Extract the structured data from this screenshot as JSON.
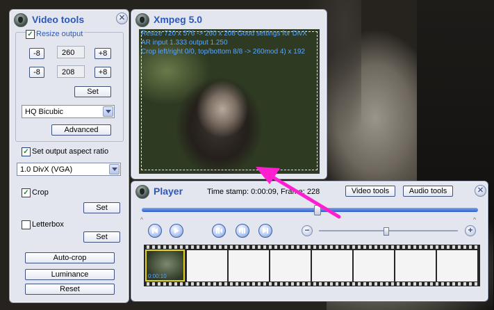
{
  "video_tools": {
    "title": "Video tools",
    "resize_output_label": "Resize output",
    "resize_output_checked": true,
    "minus8_label": "-8",
    "plus8_label": "+8",
    "width_value": "260",
    "height_value": "208",
    "set_label": "Set",
    "resize_filter": "HQ Bicubic",
    "advanced_label": "Advanced",
    "aspect_ratio_label": "Set output aspect ratio",
    "aspect_ratio_checked": true,
    "aspect_ratio_value": "1.0 DivX (VGA)",
    "crop_label": "Crop",
    "crop_checked": true,
    "letterbox_label": "Letterbox",
    "letterbox_checked": false,
    "autocrop_label": "Auto-crop",
    "luminance_label": "Luminance",
    "reset_label": "Reset"
  },
  "xmpeg": {
    "title": "Xmpeg 5.0",
    "overlay_lines": [
      "Resize 720 x 576 -> 260 x 208 Good settings for DivX",
      "AR input 1.333 output 1.250",
      "Crop left/right 0/0, top/bottom 8/8 -> 260mod 4) x 192"
    ]
  },
  "player": {
    "title": "Player",
    "timestamp_label": "Time stamp: 0:00:09, Frame: 228",
    "video_tools_button": "Video tools",
    "audio_tools_button": "Audio tools",
    "seek_position": 0.52,
    "zoom_position": 0.48,
    "frame_count": 8,
    "thumb_caption": "0:00:10"
  },
  "colors": {
    "title_blue": "#2c58b8",
    "overlay_blue": "#5aa7ff",
    "arrow_magenta": "#ff1fd0"
  }
}
